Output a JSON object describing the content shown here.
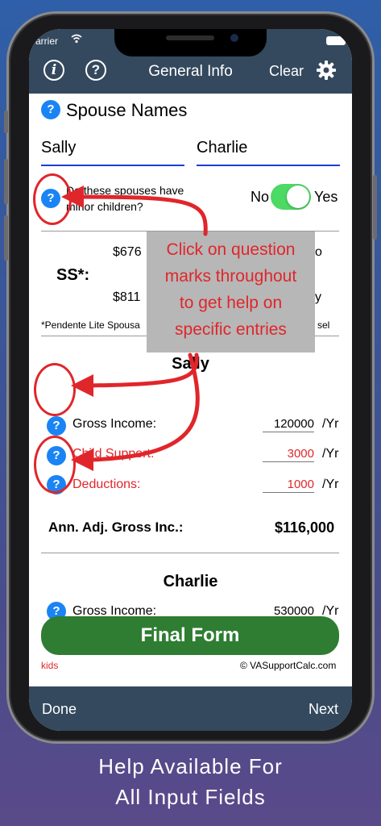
{
  "status": {
    "carrier": "arrier"
  },
  "navbar": {
    "info_icon_glyph": "i",
    "help_icon_glyph": "?",
    "title": "General Info",
    "clear_label": "Clear"
  },
  "spouse_names": {
    "label": "Spouse Names",
    "spouse1": "Sally",
    "spouse2": "Charlie"
  },
  "minor_children": {
    "question_line1": "Do these spouses have",
    "question_line2": "minor children?",
    "no_label": "No",
    "yes_label": "Yes",
    "toggle_on": true
  },
  "ss": {
    "label": "SS*:",
    "value1_partial": "$676",
    "value2_partial": "$811",
    "right1_partial": "o",
    "right2_partial": "y",
    "footnote_partial": "*Pendente Lite Spousa",
    "footnote_right_partial": "sel"
  },
  "sally": {
    "header": "Sally",
    "gross_income_label": "Gross Income:",
    "gross_income_value": "120000",
    "child_support_label": "Child Support:",
    "child_support_value": "3000",
    "deductions_label": "Deductions:",
    "deductions_value": "1000",
    "unit": "/Yr",
    "adj_label": "Ann. Adj. Gross Inc.:",
    "adj_value": "$116,000"
  },
  "charlie": {
    "header": "Charlie",
    "gross_income_label": "Gross Income:",
    "gross_income_value": "530000",
    "unit": "/Yr"
  },
  "final_form_label": "Final Form",
  "footer": {
    "left": "kids",
    "right": "© VASupportCalc.com"
  },
  "bottombar": {
    "done_label": "Done",
    "next_label": "Next"
  },
  "callout": {
    "line1": "Click on question",
    "line2": "marks throughout",
    "line3": "to get help on",
    "line4": "specific entries"
  },
  "caption": {
    "line1": "Help Available For",
    "line2": "All Input Fields"
  },
  "colors": {
    "navbar": "#34495e",
    "accent_blue": "#1a84f5",
    "alert_red": "#e0262b",
    "toggle_green": "#4cd964",
    "final_button": "#2e7d32"
  }
}
